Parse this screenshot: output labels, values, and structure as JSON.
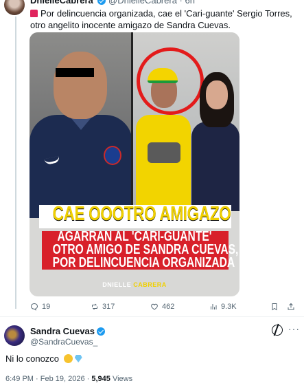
{
  "quoted_tweet": {
    "author_name": "DnielleCabrera",
    "handle_time": "@DnielleCabrera · 6h",
    "text": "Por delincuencia organizada, cae el 'Cari-guante' Sergio Torres, otro angelito inocente amigazo de Sandra Cuevas.",
    "image": {
      "headline": "CAE OOOTRO AMIGAZO",
      "sub_line_1": "AGARRAN AL 'CARI-GUANTE'",
      "sub_line_2": "OTRO AMIGO DE SANDRA CUEVAS,",
      "sub_line_3": "POR DELINCUENCIA ORGANIZADA",
      "credit_first": "DNIELLE",
      "credit_last": "CABRERA"
    },
    "actions": {
      "replies": "19",
      "reposts": "317",
      "likes": "462",
      "views": "9.3K"
    }
  },
  "reply_tweet": {
    "author_name": "Sandra Cuevas",
    "handle": "@SandraCuevas_",
    "text": "Ni lo conozco",
    "time": "6:49 PM · Feb 19, 2026 · ",
    "views_count": "5,945",
    "views_label": "Views"
  },
  "colors": {
    "accent": "#1d9bf0",
    "headline_yellow": "#f0d000",
    "band_red": "#d8202a"
  }
}
